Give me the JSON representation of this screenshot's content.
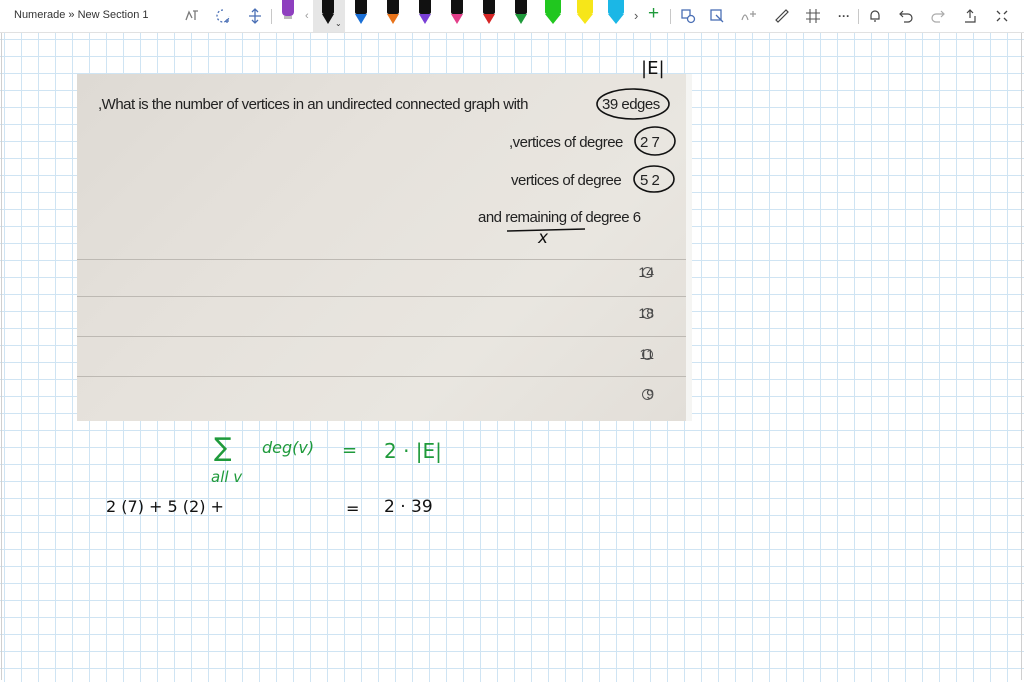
{
  "breadcrumb": "Numerade » New Section 1",
  "toolbar": {
    "lasso_icon": "lasso-select-icon",
    "add_space_icon": "add-space-icon",
    "colors": {
      "pen_purple": "#8e3fbf",
      "pen_black": "#111111",
      "pen_blue": "#1a6fd6",
      "pen_orange": "#e8731a",
      "pen_violet": "#7a3fd6",
      "pen_pink": "#e33f8a",
      "pen_red": "#d62626",
      "pen_green": "#1f9a3b",
      "hl_green": "#21c71f",
      "hl_yellow": "#f6e619",
      "hl_cyan": "#1bb7e6"
    },
    "more_label": "···"
  },
  "question": {
    "annotation_E": "|E|",
    "line1": ",What is the number of vertices in an undirected connected graph with",
    "edges": "39 edges",
    "line2a": ",vertices of degree",
    "circle2": "2 7",
    "line3a": "vertices of degree",
    "circle3": "5 2",
    "line4": "and remaining of degree 6",
    "x_label": "x",
    "options": [
      "14",
      "18",
      "11",
      "9"
    ]
  },
  "handwriting": {
    "sigma": "∑",
    "under_sigma": "all v",
    "degv": "deg(v)",
    "eq1": "=",
    "rhs1": "2 · |E|",
    "lhs2": "2 (7) +   5 (2) +",
    "eq2": "=",
    "rhs2": "2 · 39"
  }
}
